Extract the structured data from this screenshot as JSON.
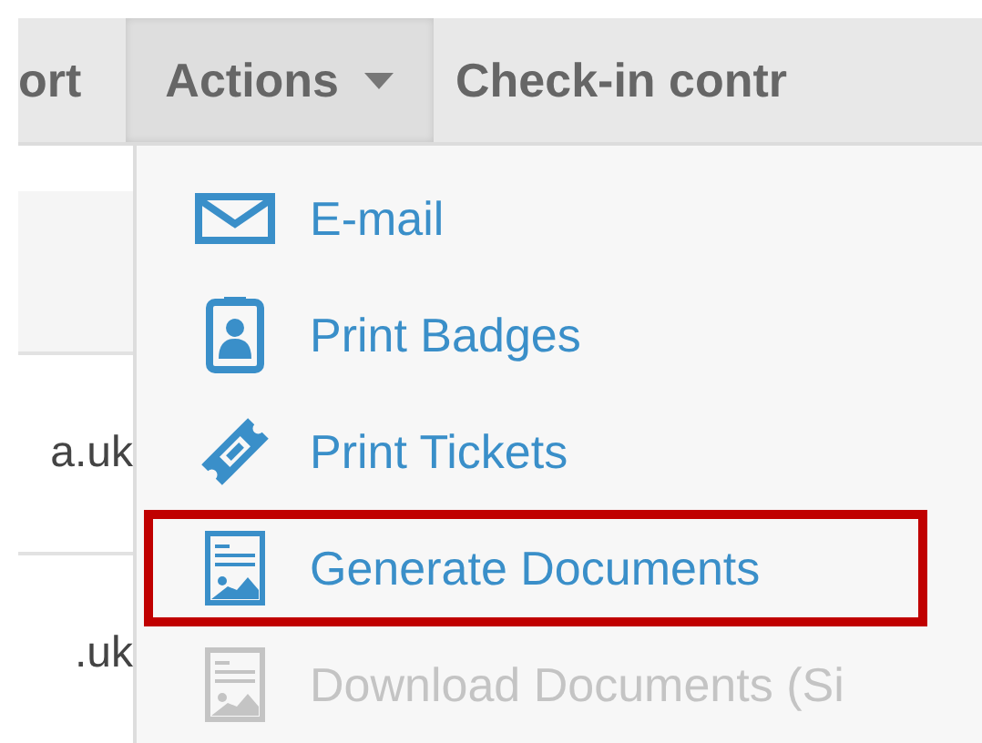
{
  "tabs": [
    {
      "label": "ort",
      "selected": false
    },
    {
      "label": "Actions",
      "selected": true,
      "has_caret": true
    },
    {
      "label": "Check-in contr",
      "selected": false
    }
  ],
  "table": {
    "rows": [
      {
        "cell": ""
      },
      {
        "cell": "a.uk"
      },
      {
        "cell": ".uk"
      }
    ]
  },
  "menu": {
    "items": [
      {
        "kind": "email",
        "label": "E-mail",
        "disabled": false,
        "highlighted": false
      },
      {
        "kind": "badge",
        "label": "Print Badges",
        "disabled": false,
        "highlighted": false
      },
      {
        "kind": "ticket",
        "label": "Print Tickets",
        "disabled": false,
        "highlighted": false
      },
      {
        "kind": "document",
        "label": "Generate Documents",
        "disabled": false,
        "highlighted": true
      },
      {
        "kind": "document",
        "label": "Download Documents (Si",
        "disabled": true,
        "highlighted": false
      }
    ]
  }
}
